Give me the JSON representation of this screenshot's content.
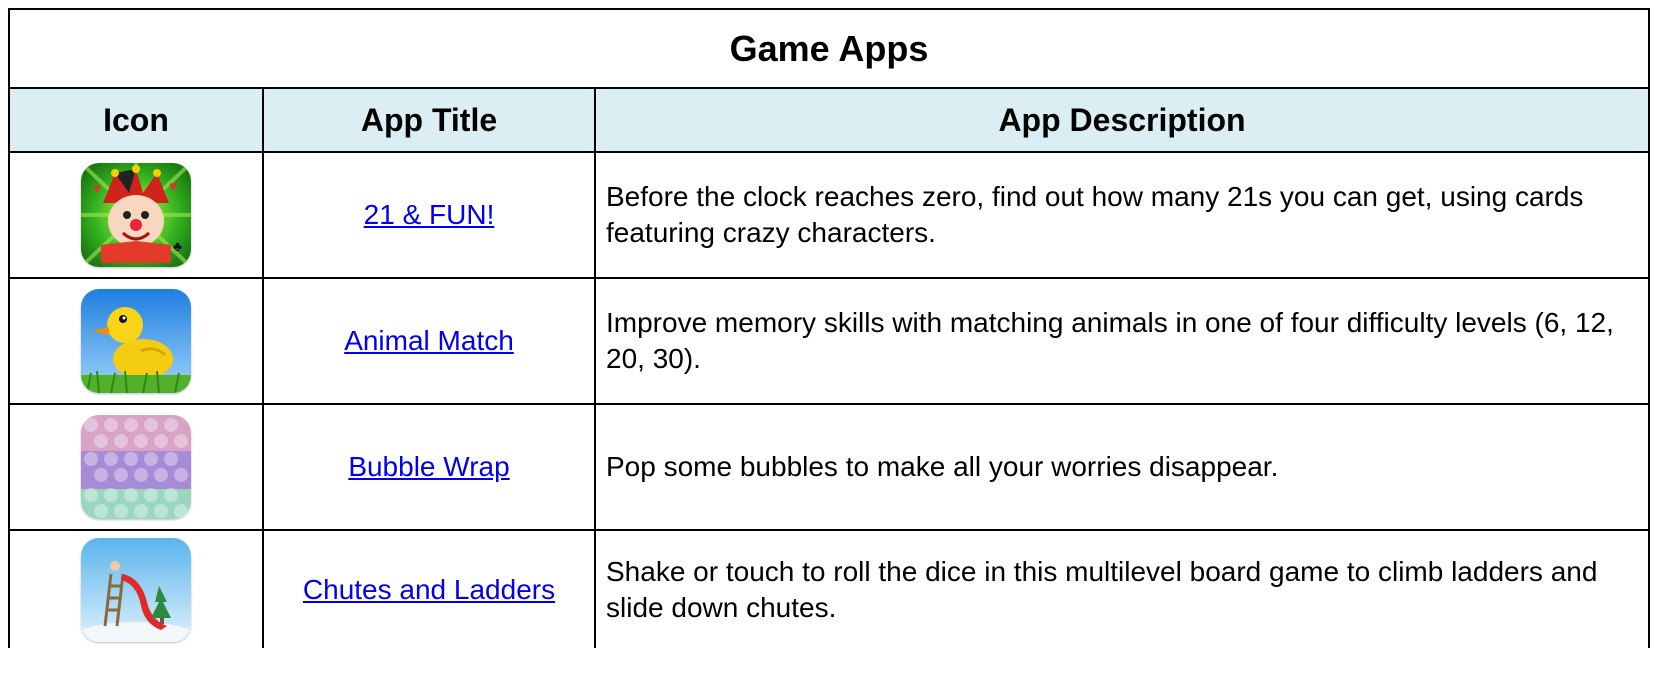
{
  "table": {
    "title": "Game Apps",
    "headers": {
      "icon": "Icon",
      "app_title": "App Title",
      "app_description": "App Description"
    },
    "rows": [
      {
        "icon": "jester-cards-icon",
        "title": "21 & FUN!",
        "description": "Before the clock reaches zero, find out how many 21s you can get, using cards featuring crazy characters."
      },
      {
        "icon": "yellow-duck-icon",
        "title": "Animal Match",
        "description": "Improve memory skills with matching animals in one of four difficulty levels (6, 12, 20, 30)."
      },
      {
        "icon": "bubble-wrap-icon",
        "title": "Bubble Wrap",
        "description": "Pop some bubbles to make all your worries disappear."
      },
      {
        "icon": "slide-ladder-icon",
        "title": "Chutes and Ladders",
        "description": "Shake or touch to roll the dice in this multilevel board game to climb ladders and slide down chutes."
      }
    ]
  },
  "colors": {
    "header_bg": "#dbeef4",
    "link": "#0000ee",
    "border": "#000000"
  }
}
